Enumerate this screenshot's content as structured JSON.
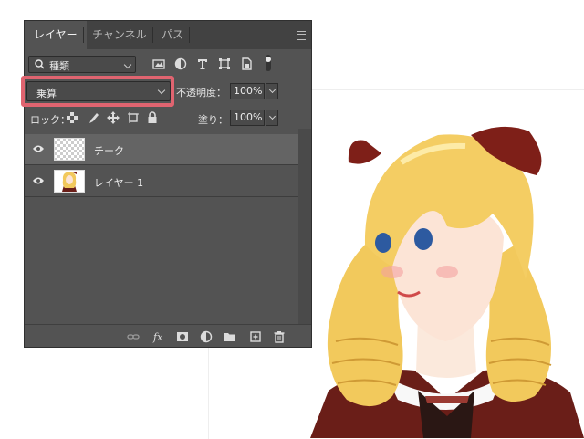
{
  "layers_panel": {
    "tabs": [
      {
        "label": "レイヤー",
        "active": true
      },
      {
        "label": "チャンネル",
        "active": false
      },
      {
        "label": "パス",
        "active": false
      }
    ],
    "filter": {
      "label": "種類",
      "icon": "search-icon"
    },
    "filter_icons": [
      "image-filter-icon",
      "adjustment-filter-icon",
      "type-filter-icon",
      "shape-filter-icon",
      "smart-object-filter-icon",
      "filter-toggle-icon"
    ],
    "blend_mode": {
      "value": "乗算"
    },
    "opacity": {
      "label": "不透明度：",
      "value": "100%"
    },
    "lock": {
      "label": "ロック：",
      "icons": [
        "lock-transparent-icon",
        "lock-image-icon",
        "lock-position-icon",
        "lock-artboard-icon",
        "lock-all-icon"
      ]
    },
    "fill": {
      "label": "塗り：",
      "value": "100%"
    },
    "layers": [
      {
        "name": "チーク",
        "visible": true,
        "selected": true,
        "thumbnail": "transparent"
      },
      {
        "name": "レイヤー 1",
        "visible": true,
        "selected": false,
        "thumbnail": "illustration"
      }
    ],
    "footer_icons": [
      "link-layers-icon",
      "fx-icon",
      "layer-mask-icon",
      "adjustment-layer-icon",
      "new-group-icon",
      "new-layer-icon",
      "trash-icon"
    ]
  },
  "colors": {
    "panel_bg": "#535353",
    "tab_bar_bg": "#424242",
    "selected_row": "#646464",
    "highlight_border": "#e06470",
    "hair": "#f2c95c",
    "ribbon": "#7e1f18",
    "dress": "#6a1e18"
  }
}
